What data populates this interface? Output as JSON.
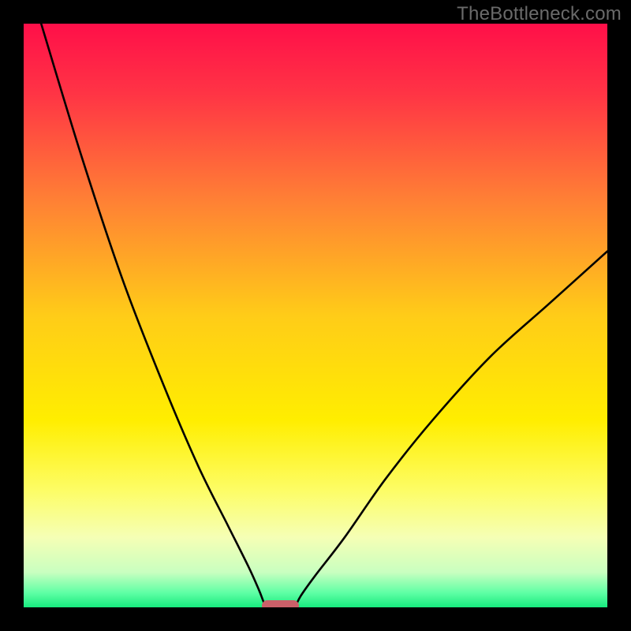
{
  "watermark": "TheBottleneck.com",
  "chart_data": {
    "type": "line",
    "title": "",
    "xlabel": "",
    "ylabel": "",
    "xlim": [
      0,
      100
    ],
    "ylim": [
      0,
      100
    ],
    "gradient_stops": [
      {
        "pos": 0.0,
        "color": "#ff0f49"
      },
      {
        "pos": 0.12,
        "color": "#ff3445"
      },
      {
        "pos": 0.3,
        "color": "#ff7f35"
      },
      {
        "pos": 0.5,
        "color": "#ffcc18"
      },
      {
        "pos": 0.68,
        "color": "#ffee00"
      },
      {
        "pos": 0.8,
        "color": "#fdfd66"
      },
      {
        "pos": 0.88,
        "color": "#f5ffb5"
      },
      {
        "pos": 0.94,
        "color": "#c9ffc0"
      },
      {
        "pos": 0.975,
        "color": "#5fffa5"
      },
      {
        "pos": 1.0,
        "color": "#17eb7e"
      }
    ],
    "series": [
      {
        "name": "left-branch",
        "x": [
          3,
          10,
          17,
          24,
          30,
          35,
          38.5,
          40.3,
          41,
          41.5
        ],
        "y": [
          100,
          77,
          56,
          38,
          24,
          14,
          7,
          3,
          1.2,
          0
        ]
      },
      {
        "name": "right-branch",
        "x": [
          46.5,
          47.5,
          50,
          55,
          62,
          70,
          80,
          90,
          100
        ],
        "y": [
          0,
          2,
          5.5,
          12,
          22,
          32,
          43,
          52,
          61
        ]
      }
    ],
    "marker": {
      "name": "bottleneck-marker",
      "x": 44,
      "y": 0,
      "width_pct": 6.3,
      "color": "#cb6069"
    }
  }
}
